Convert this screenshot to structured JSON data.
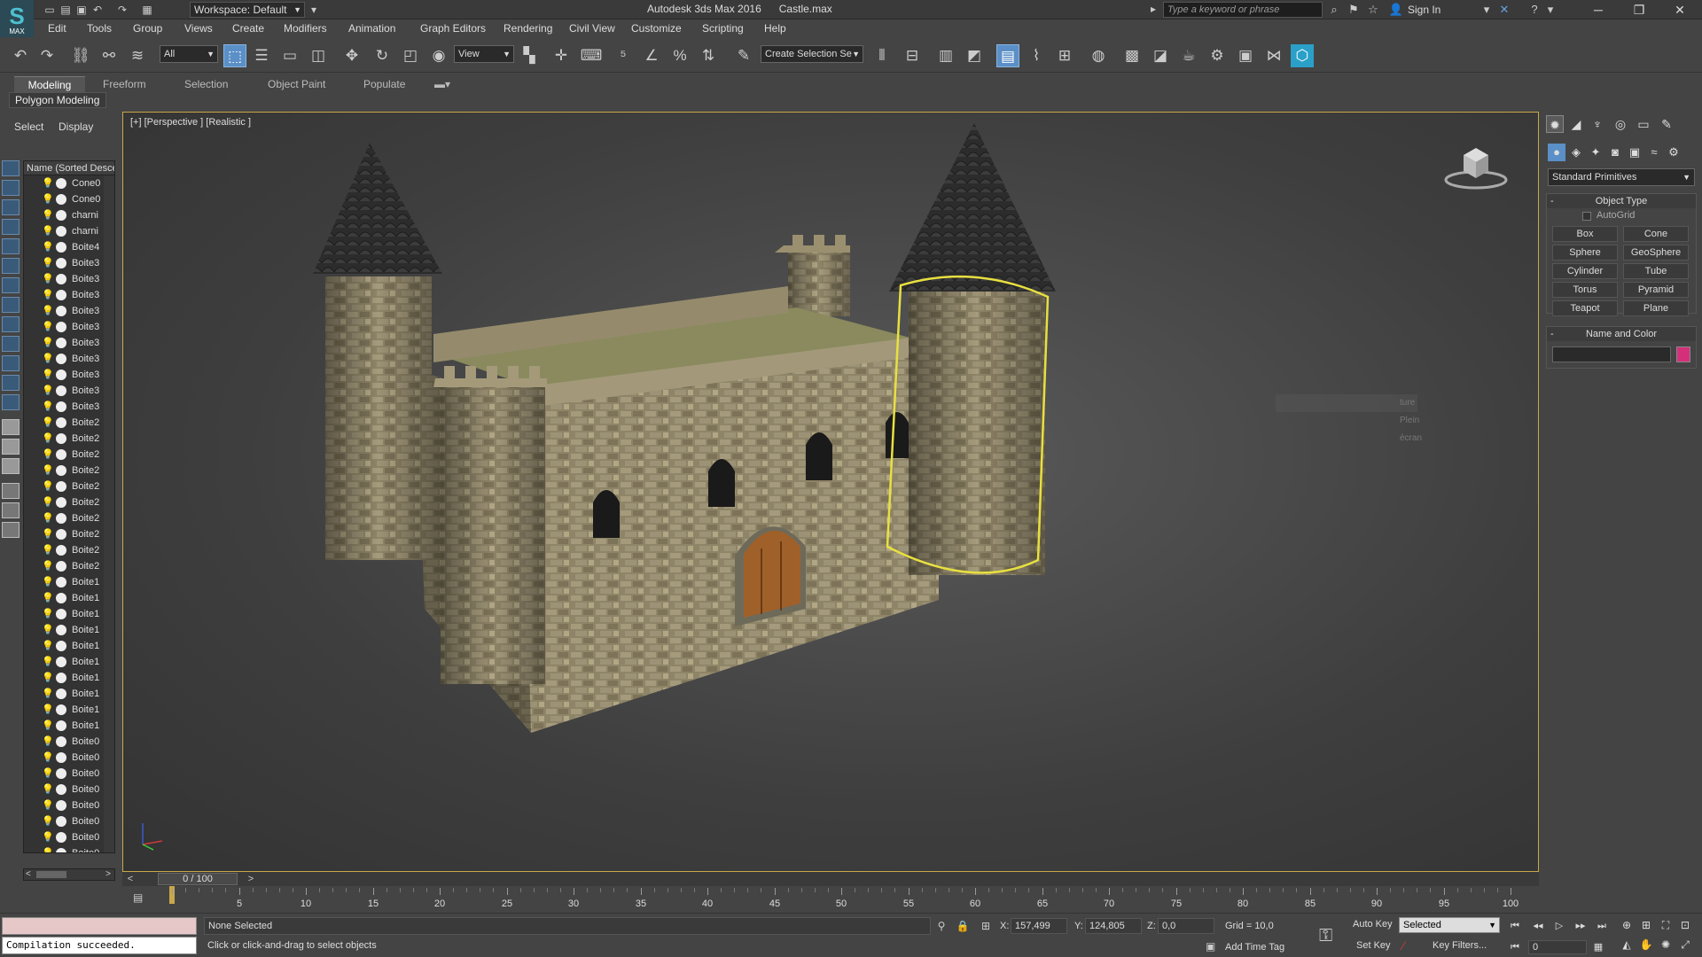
{
  "titlebar": {
    "logo_text": "S",
    "logo_sub": "MAX",
    "workspace": "Workspace: Default",
    "title": "Autodesk 3ds Max 2016",
    "filename": "Castle.max",
    "search_placeholder": "Type a keyword or phrase",
    "sign_in": "Sign In"
  },
  "menu": [
    "Edit",
    "Tools",
    "Group",
    "Views",
    "Create",
    "Modifiers",
    "Animation",
    "Graph Editors",
    "Rendering",
    "Civil View",
    "Customize",
    "Scripting",
    "Help"
  ],
  "toolbar": {
    "filter_value": "All",
    "coord_system": "View",
    "selection_set_placeholder": "Create Selection Se"
  },
  "ribbon": {
    "tabs": [
      "Modeling",
      "Freeform",
      "Selection",
      "Object Paint",
      "Populate"
    ],
    "active_tab": "Modeling",
    "panel_label": "Polygon Modeling"
  },
  "explorer": {
    "tabs": [
      "Select",
      "Display"
    ],
    "header": "Name (Sorted Descending)",
    "items": [
      "Cone0",
      "Cone0",
      "charni",
      "charni",
      "Boite4",
      "Boite3",
      "Boite3",
      "Boite3",
      "Boite3",
      "Boite3",
      "Boite3",
      "Boite3",
      "Boite3",
      "Boite3",
      "Boite3",
      "Boite2",
      "Boite2",
      "Boite2",
      "Boite2",
      "Boite2",
      "Boite2",
      "Boite2",
      "Boite2",
      "Boite2",
      "Boite2",
      "Boite1",
      "Boite1",
      "Boite1",
      "Boite1",
      "Boite1",
      "Boite1",
      "Boite1",
      "Boite1",
      "Boite1",
      "Boite1",
      "Boite0",
      "Boite0",
      "Boite0",
      "Boite0",
      "Boite0",
      "Boite0",
      "Boite0",
      "Boite0",
      "Boite0"
    ]
  },
  "viewport": {
    "label": "[+] [Perspective ] [Realistic ]",
    "ghost_text": "ture Plein écran"
  },
  "command_panel": {
    "category": "Standard Primitives",
    "object_type_title": "Object Type",
    "autogrid": "AutoGrid",
    "primitives": [
      "Box",
      "Cone",
      "Sphere",
      "GeoSphere",
      "Cylinder",
      "Tube",
      "Torus",
      "Pyramid",
      "Teapot",
      "Plane"
    ],
    "name_color_title": "Name and Color",
    "color": "#d4307a"
  },
  "timeline": {
    "slider_label": "0 / 100",
    "ticks": [
      0,
      5,
      10,
      15,
      20,
      25,
      30,
      35,
      40,
      45,
      50,
      55,
      60,
      65,
      70,
      75,
      80,
      85,
      90,
      95,
      100
    ],
    "current_frame": 0,
    "max_frame": 100
  },
  "status": {
    "maxscript_output": "Compilation succeeded.",
    "selection": "None Selected",
    "prompt": "Click or click-and-drag to select objects",
    "x_label": "X:",
    "x_value": "157,499",
    "y_label": "Y:",
    "y_value": "124,805",
    "z_label": "Z:",
    "z_value": "0,0",
    "grid": "Grid = 10,0",
    "add_time_tag": "Add Time Tag",
    "auto_key": "Auto Key",
    "set_key": "Set Key",
    "selected_mode": "Selected",
    "key_filters": "Key Filters...",
    "frame_value": "0"
  },
  "colors": {
    "selection_highlight": "#e8e040",
    "viewport_border": "#c8a84a",
    "accent": "#5b8fc7"
  }
}
